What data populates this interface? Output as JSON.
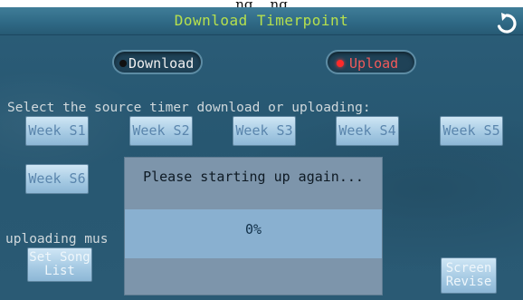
{
  "caption": "...ng... ng...",
  "title": "Download Timerpoint",
  "mode": {
    "download_label": "Download",
    "upload_label": "Upload",
    "selected": "upload"
  },
  "prompt": "Select the source timer download or uploading:",
  "weeks": [
    "Week S1",
    "Week S2",
    "Week S3",
    "Week S4",
    "Week S5",
    "Week S6"
  ],
  "uploading_text": "uploading mus",
  "set_song_list": {
    "line1": "Set Song",
    "line2": "List"
  },
  "screen_revise": {
    "line1": "Screen",
    "line2": "Revise"
  },
  "dialog": {
    "message": "Please starting up again...",
    "progress_text": "0%",
    "progress": 0
  },
  "colors": {
    "title": "#b6e04d",
    "upload_active": "#ff2a2a",
    "background": "#2a5a74",
    "button": "#a7cbe4"
  },
  "icons": {
    "back": "back-arrow-icon"
  }
}
